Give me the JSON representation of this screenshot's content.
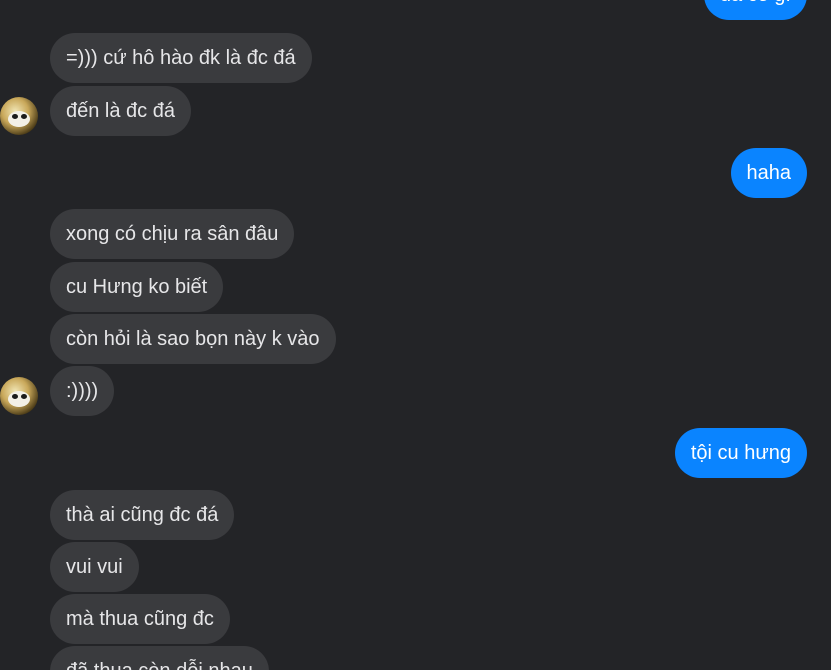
{
  "colors": {
    "background": "#232427",
    "incoming_bubble": "#3a3b3e",
    "outgoing_bubble": "#0a84ff"
  },
  "messages": [
    {
      "text": "đã có gì",
      "sender": "me"
    },
    {
      "text": "=))) cứ hô hào đk là đc đá",
      "sender": "them"
    },
    {
      "text": "đến là đc đá",
      "sender": "them"
    },
    {
      "text": "haha",
      "sender": "me"
    },
    {
      "text": "xong có chịu ra sân đâu",
      "sender": "them"
    },
    {
      "text": "cu Hưng ko biết",
      "sender": "them"
    },
    {
      "text": "còn hỏi là sao bọn này k vào",
      "sender": "them"
    },
    {
      "text": ":))))",
      "sender": "them"
    },
    {
      "text": "tội cu hưng",
      "sender": "me"
    },
    {
      "text": "thà ai cũng đc đá",
      "sender": "them"
    },
    {
      "text": "vui vui",
      "sender": "them"
    },
    {
      "text": "mà thua cũng đc",
      "sender": "them"
    },
    {
      "text": "đã thua còn dỗi nhau",
      "sender": "them"
    }
  ],
  "avatars": [
    {
      "icon": "panda-avatar-icon"
    },
    {
      "icon": "panda-avatar-icon"
    }
  ]
}
